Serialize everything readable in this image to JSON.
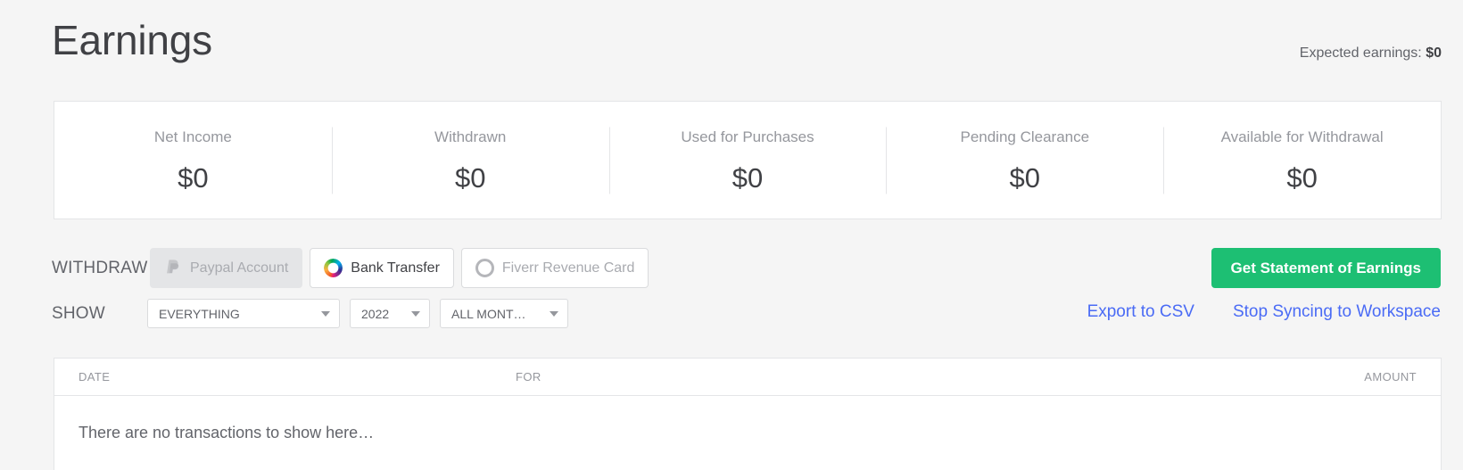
{
  "header": {
    "title": "Earnings",
    "expected_label": "Expected earnings:",
    "expected_value": "$0"
  },
  "stats": [
    {
      "label": "Net Income",
      "value": "$0"
    },
    {
      "label": "Withdrawn",
      "value": "$0"
    },
    {
      "label": "Used for Purchases",
      "value": "$0"
    },
    {
      "label": "Pending Clearance",
      "value": "$0"
    },
    {
      "label": "Available for Withdrawal",
      "value": "$0"
    }
  ],
  "withdraw": {
    "label": "WITHDRAW",
    "methods": [
      {
        "label": "Paypal Account",
        "icon": "paypal-icon",
        "state": "disabled"
      },
      {
        "label": "Bank Transfer",
        "icon": "multicolor-ring-icon",
        "state": "enabled"
      },
      {
        "label": "Fiverr Revenue Card",
        "icon": "grey-ring-icon",
        "state": "muted"
      }
    ],
    "statement_button": "Get Statement of Earnings"
  },
  "show": {
    "label": "SHOW",
    "filters": [
      {
        "name": "type-filter",
        "value": "EVERYTHING"
      },
      {
        "name": "year-filter",
        "value": "2022"
      },
      {
        "name": "month-filter",
        "value": "ALL MONT…"
      }
    ],
    "links": [
      {
        "name": "export-csv-link",
        "label": "Export to CSV"
      },
      {
        "name": "stop-syncing-link",
        "label": "Stop Syncing to Workspace"
      }
    ]
  },
  "table": {
    "columns": {
      "date": "DATE",
      "for": "FOR",
      "amount": "AMOUNT"
    },
    "empty_message": "There are no transactions to show here…",
    "rows": []
  },
  "colors": {
    "page_background": "#f5f5f5",
    "card_background": "#ffffff",
    "accent_green": "#1dbf73",
    "link_blue": "#4a6bf5",
    "text_primary": "#404145",
    "text_muted": "#95979d",
    "border": "#e4e5e7"
  }
}
